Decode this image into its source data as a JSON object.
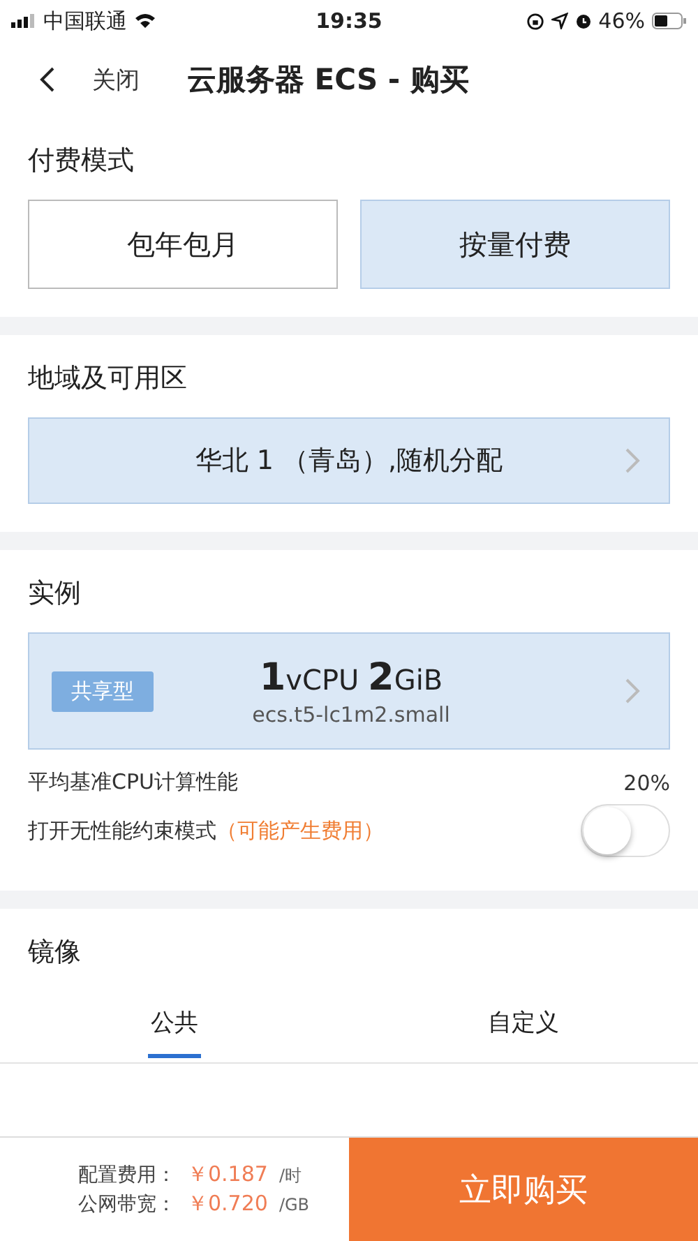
{
  "status_bar": {
    "carrier": "中国联通",
    "time": "19:35",
    "battery": "46%"
  },
  "nav": {
    "close": "关闭",
    "title": "云服务器 ECS - 购买"
  },
  "billing": {
    "title": "付费模式",
    "options": [
      {
        "label": "包年包月",
        "selected": false
      },
      {
        "label": "按量付费",
        "selected": true
      }
    ]
  },
  "region": {
    "title": "地域及可用区",
    "value": "华北 1 （青岛）,随机分配"
  },
  "instance": {
    "title": "实例",
    "tag": "共享型",
    "spec": "**1**vCPU **2**GiB",
    "type": "ecs.t5-lc1m2.small",
    "baseline_label": "平均基准CPU计算性能",
    "baseline_value": "20%",
    "unlimited": {
      "label": "打开无性能约束模式",
      "note": "（可能产生费用）",
      "on": false
    }
  },
  "image": {
    "title": "镜像",
    "tabs": [
      {
        "label": "公共",
        "selected": true
      },
      {
        "label": "自定义",
        "selected": false
      }
    ]
  },
  "footer": {
    "rows": [
      {
        "label": "配置费用：",
        "price": "￥0.187",
        "unit": "/时"
      },
      {
        "label": "公网带宽：",
        "price": "￥0.720",
        "unit": "/GB"
      }
    ],
    "buy": "立即购买"
  }
}
